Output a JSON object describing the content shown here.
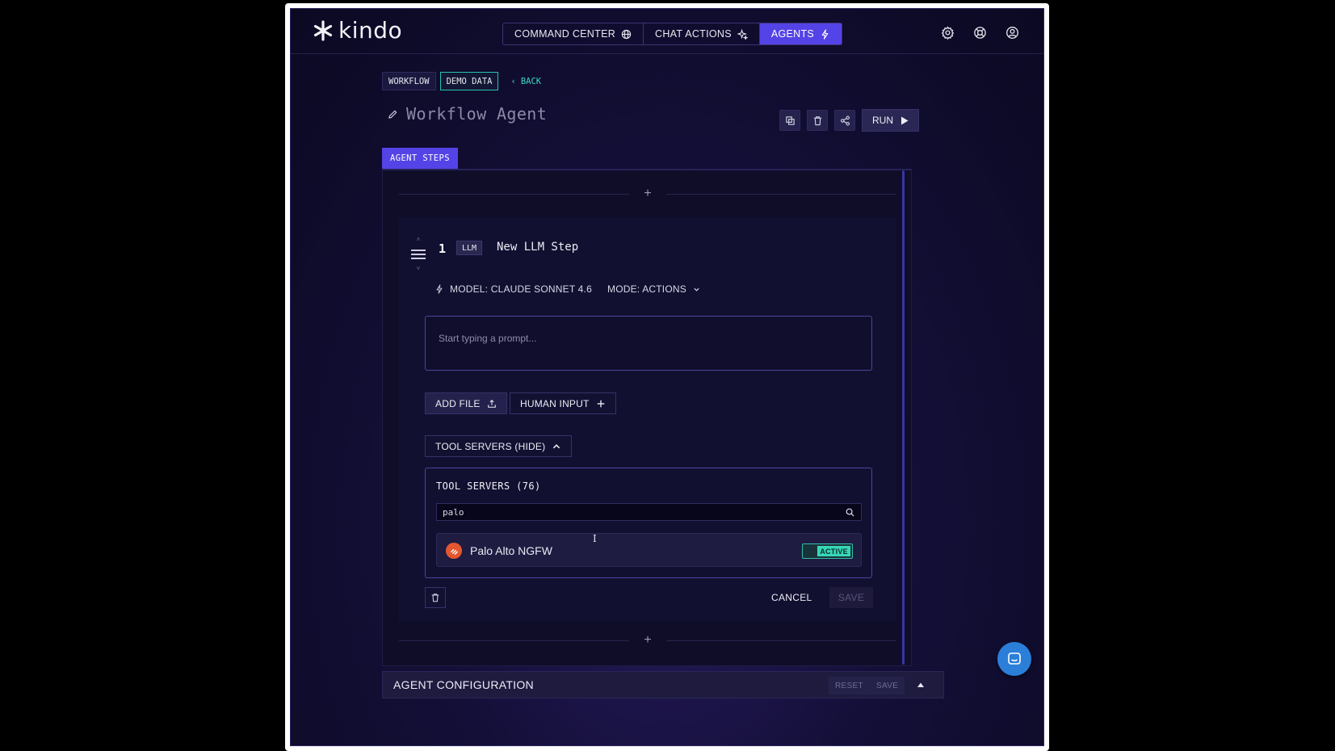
{
  "app": {
    "logo_text": "kindo"
  },
  "nav": {
    "items": [
      {
        "label": "COMMAND CENTER",
        "icon": "globe-icon",
        "active": false
      },
      {
        "label": "CHAT ACTIONS",
        "icon": "sparkle-icon",
        "active": false
      },
      {
        "label": "AGENTS",
        "icon": "lightning-icon",
        "active": true
      }
    ]
  },
  "top_icons": [
    "settings-icon",
    "help-icon",
    "user-icon"
  ],
  "breadcrumb": {
    "workflow": "WORKFLOW",
    "demo_data": "DEMO DATA",
    "back": "BACK"
  },
  "agent": {
    "title": "Workflow Agent"
  },
  "toolbar": {
    "run_label": "RUN"
  },
  "tabs": {
    "agent_steps": "AGENT STEPS"
  },
  "step": {
    "number": "1",
    "type": "LLM",
    "name": "New LLM Step",
    "model_label": "MODEL: CLAUDE SONNET 4.6",
    "mode_label": "MODE: ACTIONS",
    "prompt_placeholder": "Start typing a prompt...",
    "add_file_label": "ADD FILE",
    "human_input_label": "HUMAN INPUT",
    "tool_servers_toggle": "TOOL SERVERS (HIDE)",
    "tool_servers": {
      "title": "TOOL SERVERS (76)",
      "search_value": "palo",
      "results": [
        {
          "name": "Palo Alto NGFW",
          "status": "ACTIVE"
        }
      ]
    },
    "cancel_label": "CANCEL",
    "save_label": "SAVE"
  },
  "config": {
    "title": "AGENT CONFIGURATION",
    "reset_label": "RESET",
    "save_label": "SAVE"
  },
  "colors": {
    "accent": "#5443e6",
    "teal": "#36d7b7",
    "background": "#140f38"
  }
}
